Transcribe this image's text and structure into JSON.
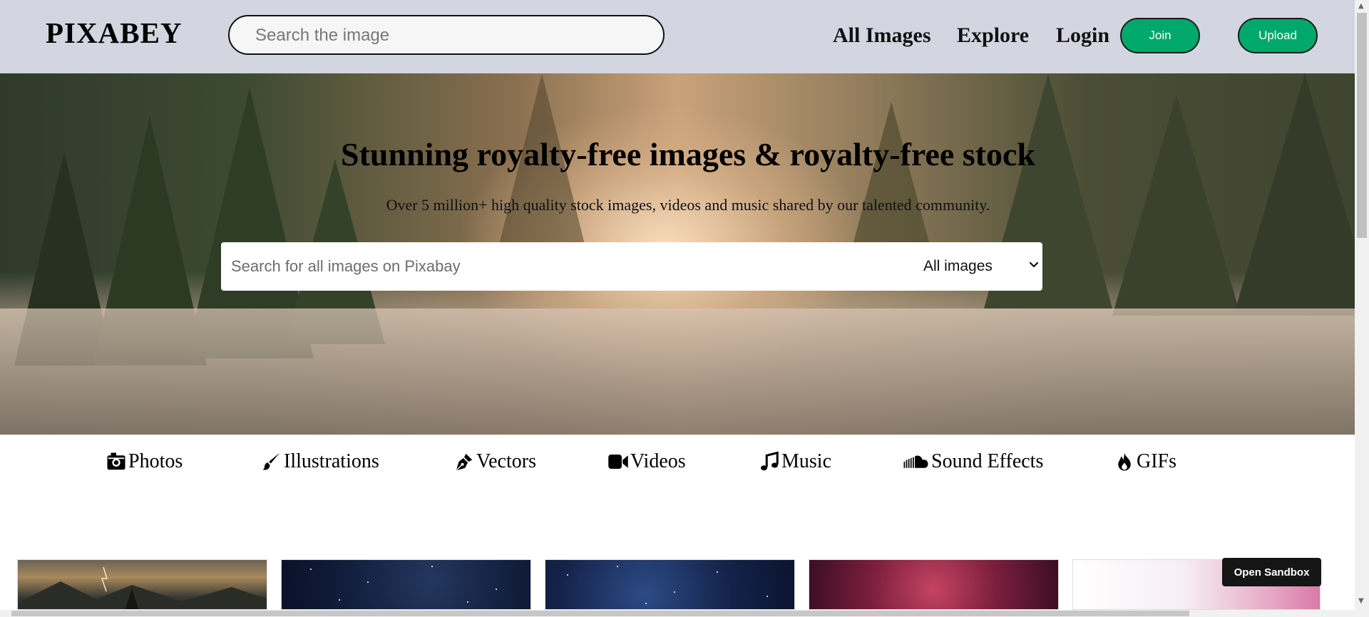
{
  "header": {
    "logo": "PIXABEY",
    "search_placeholder": "Search the image",
    "nav": [
      "All Images",
      "Explore",
      "Login"
    ],
    "join_label": "Join",
    "upload_label": "Upload",
    "join_color": "#00a86b"
  },
  "hero": {
    "title": "Stunning royalty-free images & royalty-free stock",
    "subtitle": "Over 5 million+ high quality stock images, videos and music shared by our talented community.",
    "search_placeholder": "Search for all images on Pixabay",
    "filter_value": "All images"
  },
  "categories": [
    {
      "label": "Photos",
      "icon": "camera-icon"
    },
    {
      "label": "Illustrations",
      "icon": "paintbrush-icon"
    },
    {
      "label": "Vectors",
      "icon": "pen-nib-icon"
    },
    {
      "label": "Videos",
      "icon": "video-camera-icon"
    },
    {
      "label": "Music",
      "icon": "music-note-icon"
    },
    {
      "label": "Sound Effects",
      "icon": "soundcloud-icon"
    },
    {
      "label": "GIFs",
      "icon": "fire-icon"
    }
  ],
  "sandbox_button": "Open Sandbox"
}
